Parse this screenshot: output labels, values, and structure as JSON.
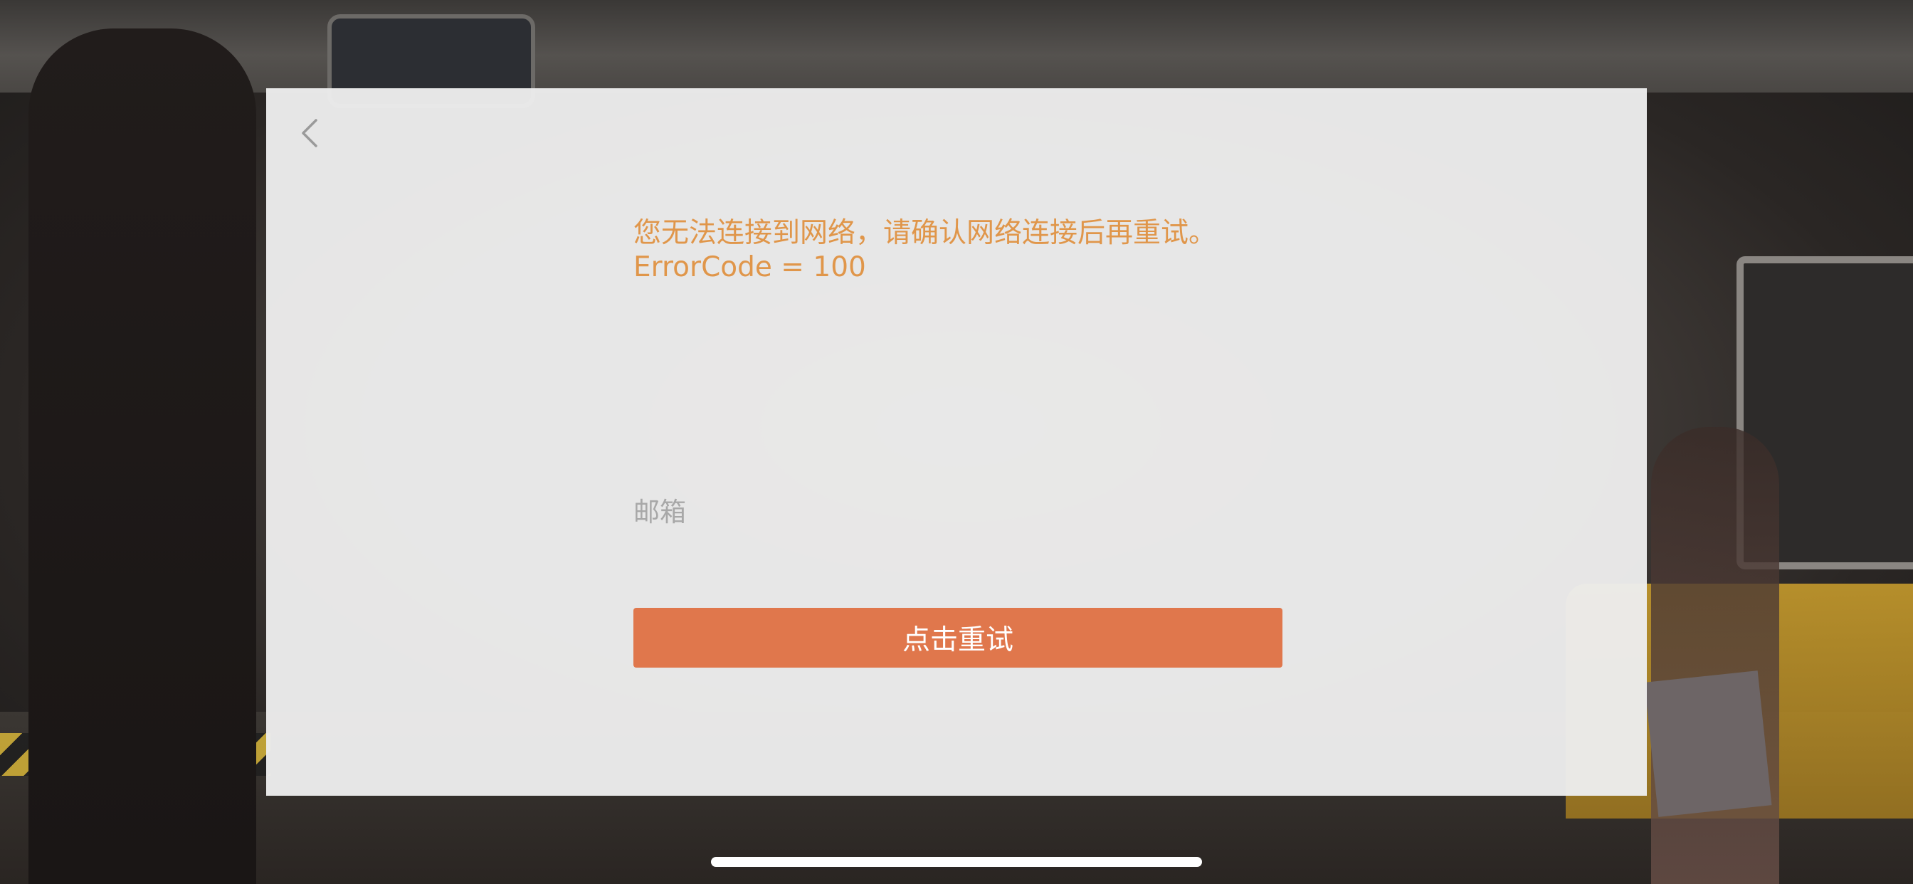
{
  "dialog": {
    "back_icon": "chevron-left-icon",
    "error_message": "您无法连接到网络，请确认网络连接后再重试。\nErrorCode = 100",
    "email_placeholder": "邮箱",
    "email_value": "",
    "retry_label": "点击重试"
  },
  "colors": {
    "error_text": "#e0964a",
    "retry_button": "#e0774c",
    "dialog_background": "#ececec",
    "placeholder_text": "#a8a8a8"
  }
}
